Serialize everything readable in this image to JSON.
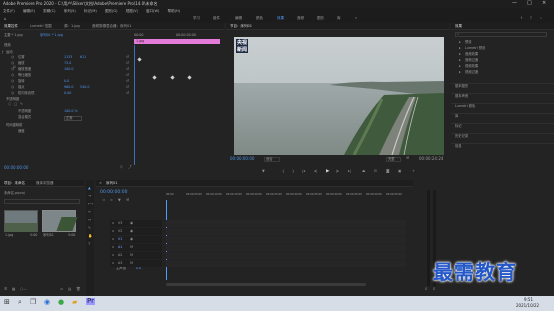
{
  "window": {
    "title": "Adobe Premiere Pro 2020 - C:\\用户\\Sliker\\文档\\Adobe\\Premiere Pro\\14.0\\未命名",
    "controls": [
      "—",
      "□",
      "×"
    ]
  },
  "menu": [
    "文件(F)",
    "编辑(E)",
    "剪辑(C)",
    "序列(S)",
    "标记(M)",
    "图形(G)",
    "视图(V)",
    "窗口(W)",
    "帮助(H)"
  ],
  "workspaces": {
    "items": [
      "学习",
      "组件",
      "编辑",
      "颜色",
      "效果",
      "音频",
      "图形",
      "库"
    ],
    "active_index": 4
  },
  "effect_controls": {
    "tabs": [
      "效果控件",
      "Lumetri 范围",
      "源：1.jpg",
      "音频剪辑混合器：序列01"
    ],
    "source_label": "主要 * 1.jpg",
    "sequence_label": "序列01 * 1.jpg",
    "timecode_start": "00:00",
    "timecode_end": "00:00:05:00",
    "clip_label": "1.jpg",
    "sections": {
      "video": "视频",
      "motion": "运动",
      "opacity": "不透明度",
      "time_remap": "时间重映射"
    },
    "props": [
      {
        "name": "位置",
        "v1": "1133",
        "v2": "611"
      },
      {
        "name": "缩放",
        "v1": "75.0",
        "v2": ""
      },
      {
        "name": "缩放宽度",
        "v1": "100.0",
        "v2": ""
      },
      {
        "name": "等比缩放",
        "v1": "",
        "v2": ""
      },
      {
        "name": "旋转",
        "v1": "0.0",
        "v2": ""
      },
      {
        "name": "锚点",
        "v1": "960.0",
        "v2": "540.0"
      },
      {
        "name": "防闪烁滤镜",
        "v1": "0.00",
        "v2": ""
      }
    ],
    "opacity_value": "100.0 %",
    "blend_label": "混合模式",
    "blend_value": "正常",
    "remap_label": "速度",
    "timecode_bottom": "00:00:00:00"
  },
  "program": {
    "tab": "节目：序列01",
    "overlay_line1": "央视",
    "overlay_line2": "新闻",
    "timecode_left": "00:00:00:00",
    "fit_label": "适合",
    "quality": "完整",
    "timecode_right": "00:00:24:24"
  },
  "effects_panel": {
    "tab": "效果",
    "items": [
      "预设",
      "Lumetri 预设",
      "音频效果",
      "音频过渡",
      "视频效果",
      "视频过渡"
    ],
    "side_panels": [
      "基本图形",
      "基本声音",
      "Lumetri 颜色",
      "库",
      "标记",
      "历史记录",
      "信息"
    ]
  },
  "project": {
    "tabs": [
      "项目：未命名",
      "媒体浏览器"
    ],
    "search_placeholder": "未命名.prproj",
    "items": [
      {
        "name": "1.jpg",
        "meta": "5:00"
      },
      {
        "name": "序列01",
        "meta": "5:00"
      }
    ]
  },
  "timeline": {
    "tab": "序列01",
    "timecode": "00:00:00:00",
    "ruler": [
      "00:00",
      "00:00:05:00",
      "00:00:10:00",
      "00:00:15:00",
      "00:00:20:00",
      "00:00:25:00",
      "00:00:30:00",
      "00:00:35:00",
      "00:00:40:00",
      "00:00:45:00",
      "00:00:50:00",
      "00:00:55:00"
    ],
    "tracks": [
      "V3",
      "V2",
      "V1",
      "A1",
      "A2",
      "A3"
    ],
    "master": "主声道",
    "master_value": "0.0",
    "clip_label": "1.jpg"
  },
  "taskbar": {
    "time": "9:51",
    "date": "2021/10/22"
  },
  "watermark": "最需教育",
  "colors": {
    "accent_blue": "#4f93e8",
    "clip_pink": "#e57bd8",
    "playhead": "#4f9cff"
  }
}
